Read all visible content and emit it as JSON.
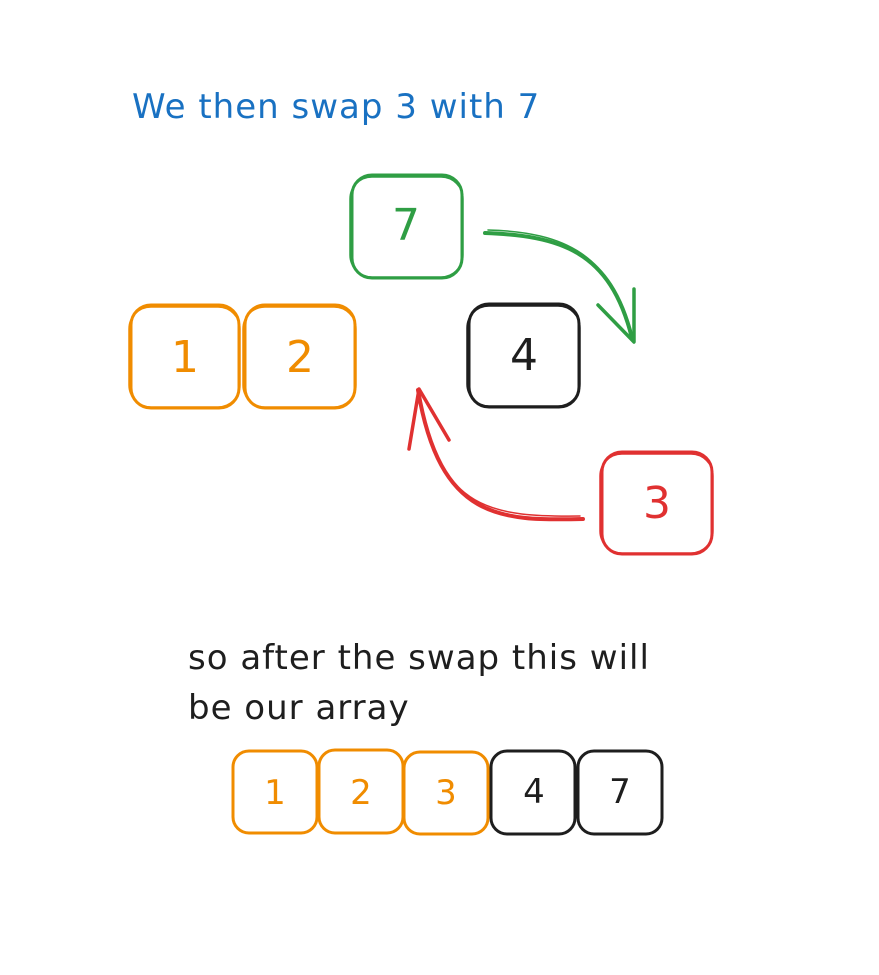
{
  "heading": "We then swap 3 with 7",
  "caption_line1": "so after the swap this will",
  "caption_line2": "be our array",
  "colors": {
    "orange": "#f08c00",
    "green": "#2f9e44",
    "red": "#e03131",
    "black": "#1e1e1e",
    "blue": "#1971c2"
  },
  "top_boxes": [
    {
      "label": "1",
      "color": "#f08c00"
    },
    {
      "label": "2",
      "color": "#f08c00"
    },
    {
      "label": "7",
      "color": "#2f9e44"
    },
    {
      "label": "4",
      "color": "#1e1e1e"
    },
    {
      "label": "3",
      "color": "#e03131"
    }
  ],
  "result_array": [
    {
      "label": "1",
      "color": "#f08c00"
    },
    {
      "label": "2",
      "color": "#f08c00"
    },
    {
      "label": "3",
      "color": "#f08c00"
    },
    {
      "label": "4",
      "color": "#1e1e1e"
    },
    {
      "label": "7",
      "color": "#1e1e1e"
    }
  ]
}
